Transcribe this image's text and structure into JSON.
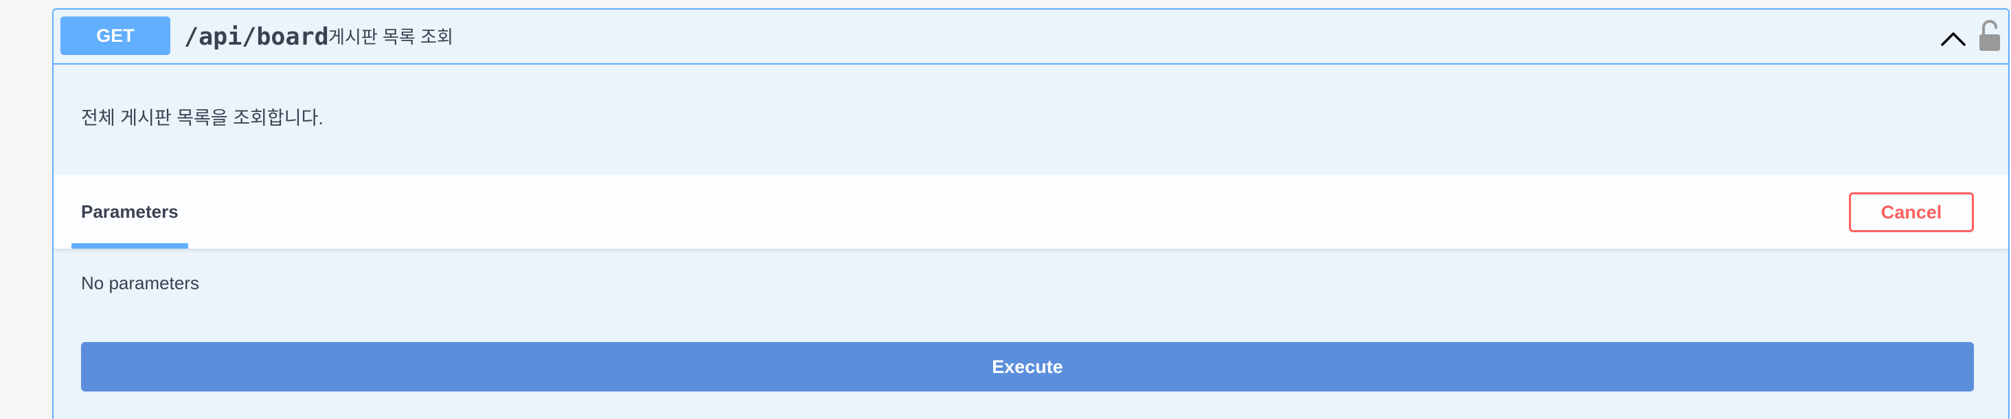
{
  "operation": {
    "method": "GET",
    "path": "/api/board",
    "summary": "게시판 목록 조회",
    "description": "전체 게시판 목록을 조회합니다.",
    "expanded": true,
    "locked": false
  },
  "parameters": {
    "tab_label": "Parameters",
    "cancel_label": "Cancel",
    "empty_text": "No parameters"
  },
  "actions": {
    "execute_label": "Execute"
  },
  "colors": {
    "get_accent": "#61affe",
    "block_background": "#ebf3fb",
    "cancel_red": "#ff6060",
    "execute_blue": "#5b8fdc",
    "text": "#3b4151"
  },
  "icons": {
    "collapse": "chevron-up-icon",
    "auth": "unlocked-padlock-icon"
  }
}
